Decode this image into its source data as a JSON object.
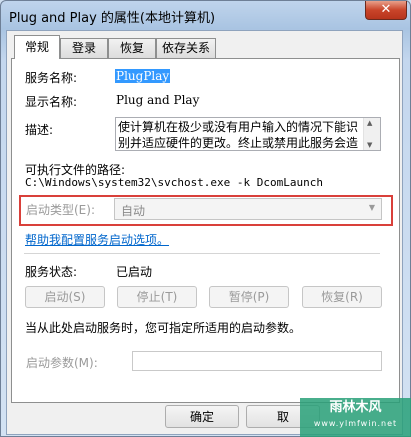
{
  "window": {
    "title": "Plug and Play 的属性(本地计算机)",
    "close_glyph": "✕"
  },
  "tabs": [
    {
      "label": "常规",
      "active": true
    },
    {
      "label": "登录",
      "active": false
    },
    {
      "label": "恢复",
      "active": false
    },
    {
      "label": "依存关系",
      "active": false
    }
  ],
  "general": {
    "service_name_label": "服务名称:",
    "service_name_value": "PlugPlay",
    "display_name_label": "显示名称:",
    "display_name_value": "Plug and Play",
    "description_label": "描述:",
    "description_value": "使计算机在极少或没有用户输入的情况下能识别并适应硬件的更改。终止或禁用此服务会造",
    "exe_path_label": "可执行文件的路径:",
    "exe_path_value": "C:\\Windows\\system32\\svchost.exe -k DcomLaunch",
    "startup_type_label": "启动类型(E):",
    "startup_type_value": "自动",
    "help_link": "帮助我配置服务启动选项。",
    "service_status_label": "服务状态:",
    "service_status_value": "已启动",
    "buttons": {
      "start": "启动(S)",
      "stop": "停止(T)",
      "pause": "暂停(P)",
      "resume": "恢复(R)"
    },
    "start_hint": "当从此处启动服务时，您可指定所适用的启动参数。",
    "start_params_label": "启动参数(M):",
    "start_params_value": ""
  },
  "footer": {
    "ok": "确定",
    "cancel": "取"
  },
  "watermark": {
    "text": "雨林木风",
    "url": "www.ylmfwin.net"
  },
  "colors": {
    "highlight": "#d9403a",
    "link": "#0066cc",
    "selection": "#3399ff"
  }
}
